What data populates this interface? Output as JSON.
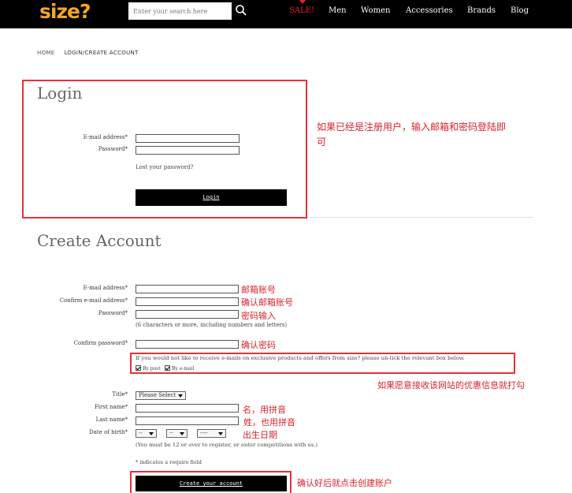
{
  "header": {
    "logo": "size?",
    "search_placeholder": "Enter your search here",
    "nav": {
      "sale": "SALE!",
      "men": "Men",
      "women": "Women",
      "accessories": "Accessories",
      "brands": "Brands",
      "blog": "Blog"
    }
  },
  "breadcrumb": {
    "home": "HOME",
    "current": "LOGIN/CREATE ACCOUNT"
  },
  "login": {
    "title": "Login",
    "email_label": "E-mail address*",
    "password_label": "Password*",
    "lost_password": "Lost your password?",
    "button": "Login"
  },
  "create": {
    "title": "Create Account",
    "email_label": "E-mail address*",
    "confirm_email_label": "Confirm e-mail address*",
    "password_label": "Password*",
    "password_hint": "(6 characters or more, including numbers and letters)",
    "confirm_password_label": "Confirm password*",
    "optin_text": "If you would not like to receive e-mails on exclusive products and offers from size? please un-tick the relevant box below.",
    "by_post": "By post",
    "by_email": "By e-mail",
    "title_label": "Title*",
    "title_select": "Please Select",
    "first_name_label": "First name*",
    "last_name_label": "Last name*",
    "dob_label": "Date of birth*",
    "dob_day": "--",
    "dob_month": "--",
    "dob_year": "----",
    "age_note": "(You must be 12 or over to register, or enter competitions with us.)",
    "required_note": "* indicates a require field",
    "button": "Create your account"
  },
  "annotations": {
    "login_note_line1": "如果已经是注册用户，输入邮箱和密码登陆即",
    "login_note_line2": "可",
    "email": "邮箱账号",
    "confirm_email": "确认邮箱账号",
    "password": "密码输入",
    "confirm_password": "确认密码",
    "optin": "如果愿意接收该网站的优惠信息就打勾",
    "first_name": "名，用拼音",
    "last_name": "姓，也用拼音",
    "dob": "出生日期",
    "submit": "确认好后就点击创建账户"
  },
  "colors": {
    "accent_logo": "#f5a623",
    "sale": "#e8202b",
    "annotation": "#e8303a"
  }
}
